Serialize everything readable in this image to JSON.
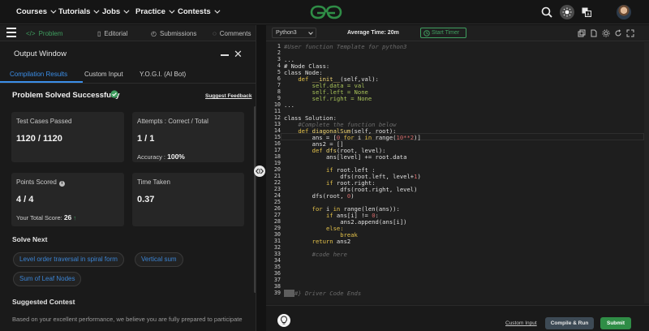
{
  "nav": {
    "items": [
      {
        "label": "Courses"
      },
      {
        "label": "Tutorials"
      },
      {
        "label": "Jobs"
      },
      {
        "label": "Practice"
      },
      {
        "label": "Contests"
      }
    ],
    "icons": [
      "geeksforgeeks-logo-icon",
      "search-icon",
      "theme-toggle-icon",
      "translate-icon",
      "user-avatar"
    ],
    "brand_color": "#2f8d46"
  },
  "problem_tabs": [
    {
      "label": "Problem",
      "icon": "code-icon"
    },
    {
      "label": "Editorial",
      "icon": "document-icon"
    },
    {
      "label": "Submissions",
      "icon": "clock-icon"
    },
    {
      "label": "Comments",
      "icon": "comment-icon"
    }
  ],
  "output": {
    "title": "Output Window",
    "tabs": [
      {
        "label": "Compilation Results"
      },
      {
        "label": "Custom Input"
      },
      {
        "label": "Y.O.G.I. (AI Bot)"
      }
    ],
    "status": "Problem Solved Successfully",
    "feedback_label": "Suggest Feedback",
    "cards": {
      "tests": {
        "label": "Test Cases Passed",
        "value": "1120 / 1120"
      },
      "attempts": {
        "label": "Attempts : Correct / Total",
        "value": "1 / 1",
        "extra_label": "Accuracy :",
        "extra_value": "100%"
      },
      "points": {
        "label": "Points Scored",
        "value": "4 / 4",
        "extra_label": "Your Total Score:",
        "extra_value": "26"
      },
      "time": {
        "label": "Time Taken",
        "value": "0.37"
      }
    },
    "solve_next_title": "Solve Next",
    "solve_next": [
      {
        "label": "Level order traversal in spiral form"
      },
      {
        "label": "Vertical sum"
      },
      {
        "label": "Sum of Leaf Nodes"
      }
    ],
    "suggested_title": "Suggested Contest",
    "suggested_text": "Based on your excellent performance, we believe you are fully prepared to participate"
  },
  "editor": {
    "language": "Python3",
    "avg_time": "Average Time: 20m",
    "start_timer": "Start Timer",
    "line_numbers": [
      "1",
      "2",
      "3",
      "4",
      "5",
      "6",
      "7",
      "8",
      "9",
      "10",
      "11",
      "12",
      "13",
      "14",
      "15",
      "16",
      "17",
      "18",
      "19",
      "20",
      "21",
      "22",
      "23",
      "24",
      "25",
      "26",
      "27",
      "28",
      "29",
      "30",
      "31",
      "32",
      "33",
      "34",
      "35",
      "36",
      "37",
      "38",
      "39"
    ],
    "code": {
      "l1": "#User function Template for python3",
      "l3": "...",
      "l4": "# Node Class:",
      "l5": "class Node:",
      "l6a": "def",
      "l6b": "__init__",
      "l6c": "(self,val):",
      "l7": "self.data = val",
      "l8": "self.left = None",
      "l9": "self.right = None",
      "l10": "...",
      "l12a": "class",
      "l12b": "Solution:",
      "l13": "#Complete the function below",
      "l14a": "def",
      "l14b": "diagonalSum",
      "l14c": "(self, root):",
      "l15a": "ans = [",
      "l15b": "0",
      "l15c": "for",
      "l15d": "i",
      "l15e": "in",
      "l15f": "range(",
      "l15g": "10**2",
      "l15h": ")]",
      "l16a": "ans2 = []",
      "l17a": "def",
      "l17b": "dfs",
      "l17c": "(root, level):",
      "l18a": "ans[level] += root.data",
      "l20a": "if",
      "l20b": "root.left :",
      "l21a": "dfs(root.left, level+",
      "l21b": "1",
      "l21c": ")",
      "l22a": "if",
      "l22b": "root.right:",
      "l23a": "dfs(root.right, level)",
      "l24a": "dfs(root,",
      "l24b": "0",
      "l24c": ")",
      "l26a": "for",
      "l26b": "i",
      "l26c": "in",
      "l26d": "range(len(ans)):",
      "l27a": "if",
      "l27b": "ans[i] !=",
      "l27c": "0",
      "l27d": ":",
      "l28a": "ans2.append(ans[i])",
      "l29a": "else:",
      "l30a": "break",
      "l31a": "return",
      "l31b": "ans2",
      "l33": "#code here",
      "l39": "#} Driver Code Ends"
    },
    "custom_input": "Custom Input",
    "compile_run": "Compile & Run",
    "submit": "Submit"
  }
}
